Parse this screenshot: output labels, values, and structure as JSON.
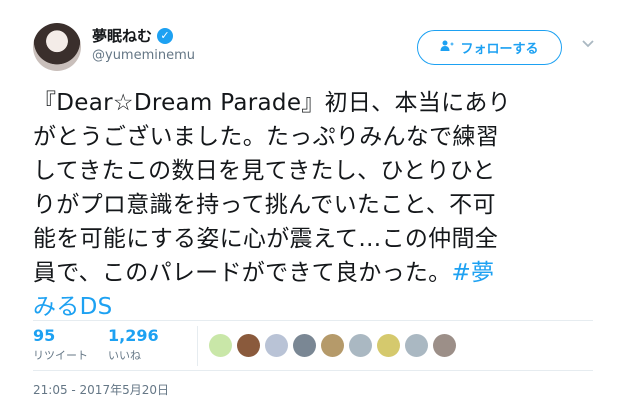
{
  "user": {
    "display_name": "夢眠ねむ",
    "handle": "@yumeminemu",
    "verified_glyph": "✓"
  },
  "follow_button": {
    "icon": "person-add-icon",
    "label": "フォローする"
  },
  "menu": {
    "icon": "chevron-down-icon"
  },
  "tweet": {
    "lines": [
      "『Dear☆Dream Parade』初日、本当にあり",
      "がとうございました。たっぷりみんなで練習",
      "してきたこの数日を見てきたし、ひとりひと",
      "りがプロ意識を持って挑んでいたこと、不可",
      "能を可能にする姿に心が震えて…この仲間全",
      "員で、このパレードができて良かった。"
    ],
    "hashtag_part1": "#夢",
    "hashtag_part2": "みるDS"
  },
  "stats": {
    "retweets": {
      "value": "95",
      "label": "リツイート"
    },
    "likes": {
      "value": "1,296",
      "label": "いいね"
    }
  },
  "likers": [
    {
      "name": "liker-avatar",
      "color": "#c9e7a8"
    },
    {
      "name": "liker-avatar",
      "color": "#8a5a3c"
    },
    {
      "name": "liker-avatar",
      "color": "#b9c3d6"
    },
    {
      "name": "liker-avatar",
      "color": "#7a8794"
    },
    {
      "name": "liker-avatar",
      "color": "#b59a6a"
    },
    {
      "name": "liker-avatar",
      "color": "#aab8c2"
    },
    {
      "name": "liker-avatar",
      "color": "#d5c96d"
    },
    {
      "name": "liker-avatar",
      "color": "#aab8c2"
    },
    {
      "name": "liker-avatar",
      "color": "#9c8f88"
    }
  ],
  "timestamp": "21:05 - 2017年5月20日",
  "colors": {
    "accent": "#1da1f2",
    "text": "#14171a",
    "muted": "#657786"
  }
}
